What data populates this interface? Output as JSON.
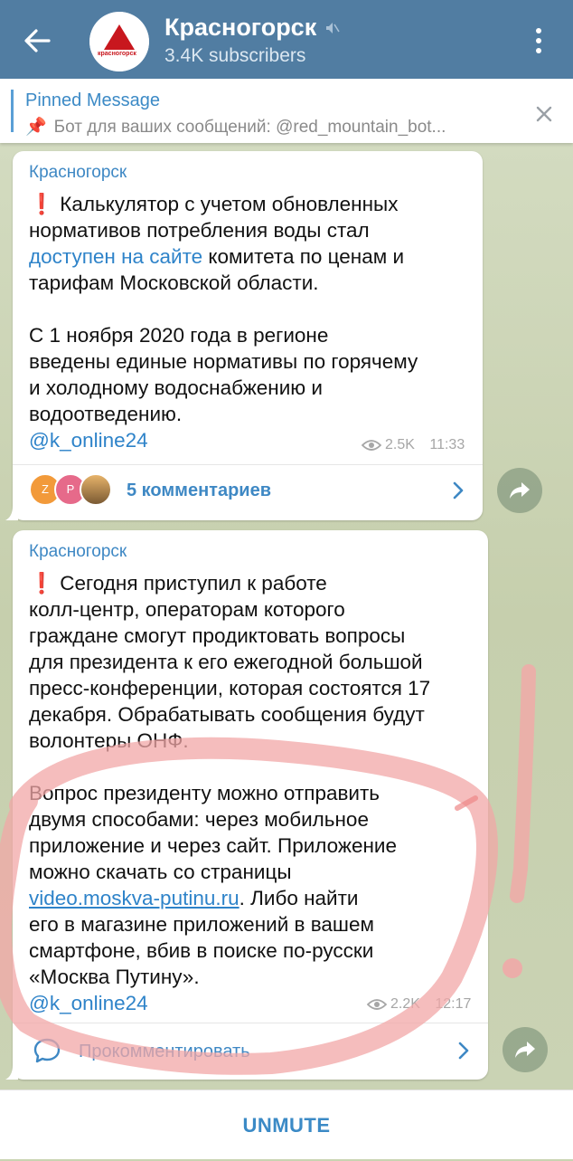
{
  "header": {
    "title": "Красногорск",
    "subtitle": "3.4K subscribers",
    "avatar_text": "красногорск"
  },
  "pinned": {
    "title": "Pinned Message",
    "emoji": "📌",
    "text": "Бот для ваших сообщений: @red_mountain_bot..."
  },
  "messages": [
    {
      "author": "Красногорск",
      "mark": "❗",
      "text_before_link": " Калькулятор с учетом обновленных\nнормативов потребления воды стал\n",
      "link": "доступен на сайте",
      "text_after_link": " комитета по ценам и\nтарифам Московской области.\n\nС 1 ноября 2020 года в регионе\nвведены единые нормативы по горячему\nи холодному водоснабжению и\nводоотведению.\n",
      "mention": "@k_online24",
      "views": "2.5K",
      "time": "11:33",
      "comment_avatars": [
        "Z",
        "P",
        ""
      ],
      "comments_label": "5 комментариев"
    },
    {
      "author": "Красногорск",
      "mark": "❗",
      "text_part1": " Сегодня приступил к работе\nколл-центр, операторам которого\nграждане смогут продиктовать вопросы\nдля президента к его ежегодной большой\nпресс-конференции, которая состоятся 17\nдекабря. Обрабатывать сообщения будут\nволонтеры ОНФ.\n\nВопрос президенту можно отправить\nдвумя способами: через мобильное\nприложение и через сайт. Приложение\nможно скачать со страницы\n",
      "link": "video.moskva-putinu.ru",
      "text_part2": ". Либо найти\nего в магазине приложений в вашем\nсмартфоне, вбив в поиске по-русски\n«Москва Путину».\n",
      "mention": "@k_online24",
      "views": "2.2K",
      "time": "12:17",
      "comments_label": "Прокомментировать"
    }
  ],
  "bottom": {
    "unmute_label": "UNMUTE"
  },
  "colors": {
    "header": "#517da2",
    "accent": "#3e88c4",
    "annotation": "#f2a7a7"
  },
  "icons": [
    "back-arrow-icon",
    "muted-icon",
    "more-vert-icon",
    "pin-icon",
    "close-icon",
    "eye-icon",
    "chevron-right-icon",
    "share-icon",
    "comment-bubble-icon"
  ]
}
